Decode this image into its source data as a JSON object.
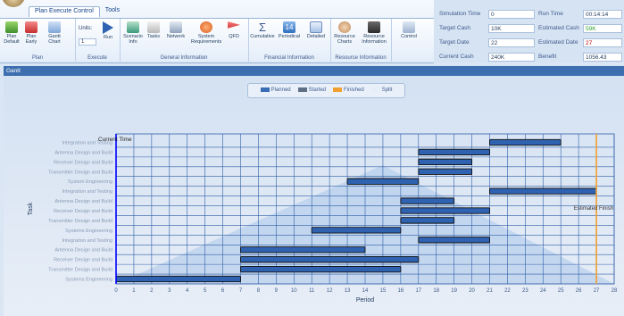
{
  "ribbon": {
    "tabs": [
      "Plan Execute Control",
      "Tools"
    ],
    "groups": [
      {
        "label": "Plan",
        "buttons": [
          "Plan Default",
          "Plan Early",
          "Gantt Chart"
        ]
      },
      {
        "label": "Execute",
        "buttons": [
          "Units:",
          "1",
          "Run"
        ]
      },
      {
        "label": "General Information",
        "buttons": [
          "Scenario Info",
          "Tasks",
          "Network",
          "System Requirements",
          "QFD"
        ]
      },
      {
        "label": "Financial Information",
        "buttons": [
          "Cumulative",
          "Periodical",
          "Detailed"
        ]
      },
      {
        "label": "Resource Information",
        "buttons": [
          "Resource Charts",
          "Resource Information"
        ]
      },
      {
        "label": "",
        "buttons": [
          "Control"
        ]
      }
    ]
  },
  "status": {
    "simulation_time_label": "Simulation Time",
    "simulation_time": "0",
    "target_cash_label": "Target Cash",
    "target_cash": "10K",
    "target_date_label": "Target Date",
    "target_date": "22",
    "current_cash_label": "Current Cash",
    "current_cash": "240K",
    "run_time_label": "Run Time",
    "run_time": "00:14:14",
    "estimated_cash_label": "Estimated Cash",
    "estimated_cash": "59K",
    "estimated_date_label": "Estimated Date",
    "estimated_date": "27",
    "benefit_label": "Benefit",
    "benefit": "1056.43",
    "colors": {
      "estimated_cash": "#2e9b2e",
      "estimated_date": "#c00000"
    }
  },
  "panel": {
    "title": "Gantt"
  },
  "legend": [
    {
      "label": "Planned",
      "color": "#3b6db4"
    },
    {
      "label": "Started",
      "color": "#5f6f86"
    },
    {
      "label": "Finished",
      "color": "#f0a030"
    },
    {
      "label": "Split",
      "color": "#e6eef8"
    }
  ],
  "chart_data": {
    "type": "gantt",
    "xlabel": "Period",
    "ylabel": "Task",
    "xlim": [
      0,
      28
    ],
    "xticks": [
      0,
      1,
      2,
      3,
      4,
      5,
      6,
      7,
      8,
      9,
      10,
      11,
      12,
      13,
      14,
      15,
      16,
      17,
      18,
      19,
      20,
      21,
      22,
      23,
      24,
      25,
      26,
      27,
      28
    ],
    "tasks": [
      {
        "name": "Integration and Testing",
        "start": 21,
        "end": 25
      },
      {
        "name": "Antenna Design and Build",
        "start": 17,
        "end": 21
      },
      {
        "name": "Receiver Design and Build",
        "start": 17,
        "end": 20
      },
      {
        "name": "Transmitter Design and Build",
        "start": 17,
        "end": 20
      },
      {
        "name": "System Engineering",
        "start": 13,
        "end": 17
      },
      {
        "name": "Integration and Testing",
        "start": 21,
        "end": 27
      },
      {
        "name": "Antenna Design and Build",
        "start": 16,
        "end": 19
      },
      {
        "name": "Receiver Design and Build",
        "start": 16,
        "end": 21
      },
      {
        "name": "Transmitter Design and Build",
        "start": 16,
        "end": 19
      },
      {
        "name": "Systems Engineering",
        "start": 11,
        "end": 16
      },
      {
        "name": "Integration and Testing",
        "start": 17,
        "end": 21
      },
      {
        "name": "Antenna Design and Build",
        "start": 7,
        "end": 14
      },
      {
        "name": "Receiver Design and Build",
        "start": 7,
        "end": 17
      },
      {
        "name": "Transmitter Design and Build",
        "start": 7,
        "end": 16
      },
      {
        "name": "Systems Engineering",
        "start": 0,
        "end": 7
      }
    ],
    "annotations": [
      {
        "text": "Current Time",
        "x": 0
      },
      {
        "text": "Estimated Finish",
        "x": 27
      }
    ],
    "colors": {
      "bar": "#2f62b0",
      "current_time": "#0000ff",
      "estimated_finish": "#f0a030",
      "grid": "#2f5fa8"
    }
  }
}
